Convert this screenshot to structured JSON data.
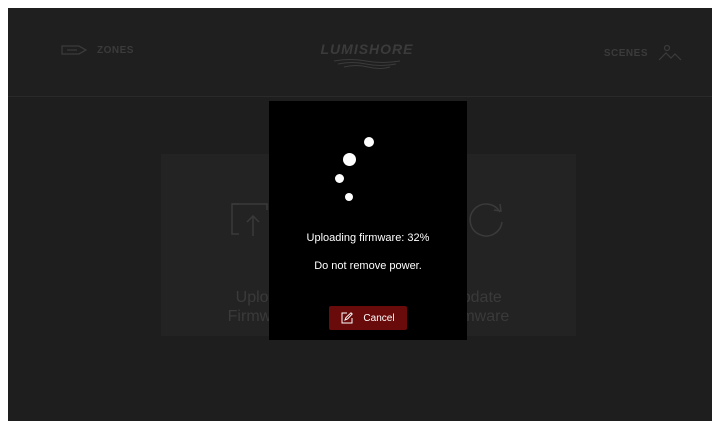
{
  "header": {
    "zones_label": "ZONES",
    "scenes_label": "SCENES",
    "logo_text": "LUMISHORE",
    "zones_icon": "boat-icon",
    "scenes_icon": "person-landscape-icon"
  },
  "cards": [
    {
      "icon": "upload-tray-icon",
      "label_line1": "Upload",
      "label_line2": "Firmware"
    },
    {
      "icon": "refresh-icon",
      "label_line1": "Update",
      "label_line2": "Firmware"
    }
  ],
  "modal": {
    "progress_prefix": "Uploading firmware:",
    "progress_value": 32,
    "progress_text": "Uploading firmware: 32%",
    "warning_text": "Do not remove power.",
    "cancel_label": "Cancel",
    "cancel_icon": "edit-icon"
  },
  "colors": {
    "background": "#1e1e1e",
    "modal": "#000000",
    "cancel_button": "#6a0b0b",
    "text": "#ffffff",
    "dim_text": "#3b3b3b"
  }
}
